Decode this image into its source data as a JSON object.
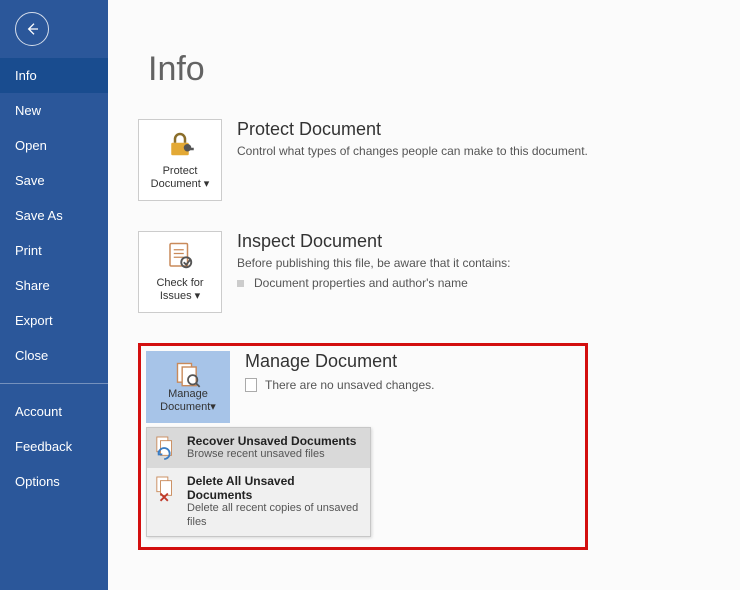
{
  "colors": {
    "brand": "#2b579a",
    "accent": "#194c8f",
    "highlight": "#d30f0f"
  },
  "sidebar": {
    "items": [
      {
        "label": "Info",
        "selected": true
      },
      {
        "label": "New"
      },
      {
        "label": "Open"
      },
      {
        "label": "Save"
      },
      {
        "label": "Save As"
      },
      {
        "label": "Print"
      },
      {
        "label": "Share"
      },
      {
        "label": "Export"
      },
      {
        "label": "Close"
      }
    ],
    "footer_items": [
      {
        "label": "Account"
      },
      {
        "label": "Feedback"
      },
      {
        "label": "Options"
      }
    ]
  },
  "page": {
    "title": "Info"
  },
  "sections": {
    "protect": {
      "tile_line1": "Protect",
      "tile_line2": "Document",
      "title": "Protect Document",
      "desc": "Control what types of changes people can make to this document."
    },
    "inspect": {
      "tile_line1": "Check for",
      "tile_line2": "Issues",
      "title": "Inspect Document",
      "desc": "Before publishing this file, be aware that it contains:",
      "bullet": "Document properties and author's name"
    },
    "manage": {
      "tile_line1": "Manage",
      "tile_line2": "Document",
      "title": "Manage Document",
      "status": "There are no unsaved changes.",
      "menu": [
        {
          "title": "Recover Unsaved Documents",
          "desc": "Browse recent unsaved files"
        },
        {
          "title": "Delete All Unsaved Documents",
          "desc": "Delete all recent copies of unsaved files"
        }
      ]
    }
  }
}
